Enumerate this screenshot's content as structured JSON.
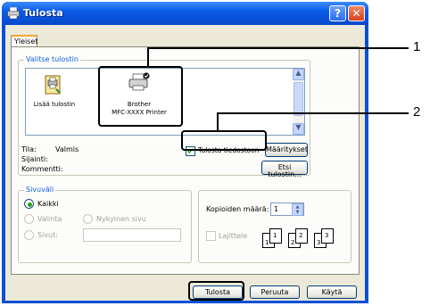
{
  "window": {
    "title": "Tulosta",
    "help_glyph": "?",
    "close_glyph": "✕"
  },
  "tabs": [
    {
      "label": "Yleiset"
    }
  ],
  "select_printer": {
    "group_title": "Valitse tulostin",
    "items": [
      {
        "label": "Lisää tulostin"
      },
      {
        "label": "Brother\nMFC-XXXX  Printer",
        "selected": true
      }
    ],
    "scroll_up": "▲",
    "scroll_down": "▼"
  },
  "status": {
    "status_label": "Tila:",
    "status_value": "Valmis",
    "location_label": "Sijainti:",
    "comment_label": "Kommentti:"
  },
  "print_to_file": {
    "label": "Tulosta tiedostoon",
    "checked": true
  },
  "preferences_button": "Määritykset",
  "find_printer_button": "Etsi tulostin...",
  "page_range": {
    "group_title": "Sivuväli",
    "all_label": "Kaikki",
    "selection_label": "Valinta",
    "current_page_label": "Nykyinen sivu",
    "pages_label": "Sivut:",
    "pages_value": ""
  },
  "copies": {
    "label": "Kopioiden määrä:",
    "value": "1",
    "collate_label": "Lajittele",
    "collate_pages": [
      "1",
      "1",
      "2",
      "2",
      "3",
      "3"
    ]
  },
  "buttons": {
    "print": "Tulosta",
    "cancel": "Peruuta",
    "apply": "Käytä"
  },
  "callouts": [
    "1",
    "2"
  ]
}
